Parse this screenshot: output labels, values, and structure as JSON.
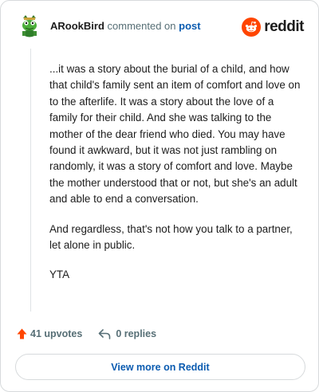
{
  "comment": {
    "username": "ARookBird",
    "action_text": "commented on",
    "post_link": "post",
    "paragraphs": [
      "...it was a story about the burial of a child, and how that child's family sent an item of comfort and love on to the afterlife. It was a story about the love of a family for their child. And she was talking to the mother of the dear friend who died. You may have found it awkward, but it was not just rambling on randomly, it was a story of comfort and love. Maybe the mother understood that or not, but she's an adult and able to end a conversation.",
      "And regardless, that's not how you talk to a partner, let alone in public.",
      "YTA"
    ],
    "upvotes_label": "41 upvotes",
    "replies_label": "0 replies"
  },
  "brand": {
    "wordmark": "reddit",
    "icon": "reddit-snoo-icon",
    "color": "#ff4500"
  },
  "footer": {
    "view_more_label": "View more on Reddit"
  },
  "icons": {
    "avatar": "frog-avatar-icon",
    "upvote": "upvote-arrow-icon",
    "reply": "reply-arrow-icon"
  },
  "colors": {
    "accent_link": "#0a5bb0",
    "upvote": "#ff4500",
    "muted_text": "#576f76",
    "border": "#d7dadc"
  }
}
